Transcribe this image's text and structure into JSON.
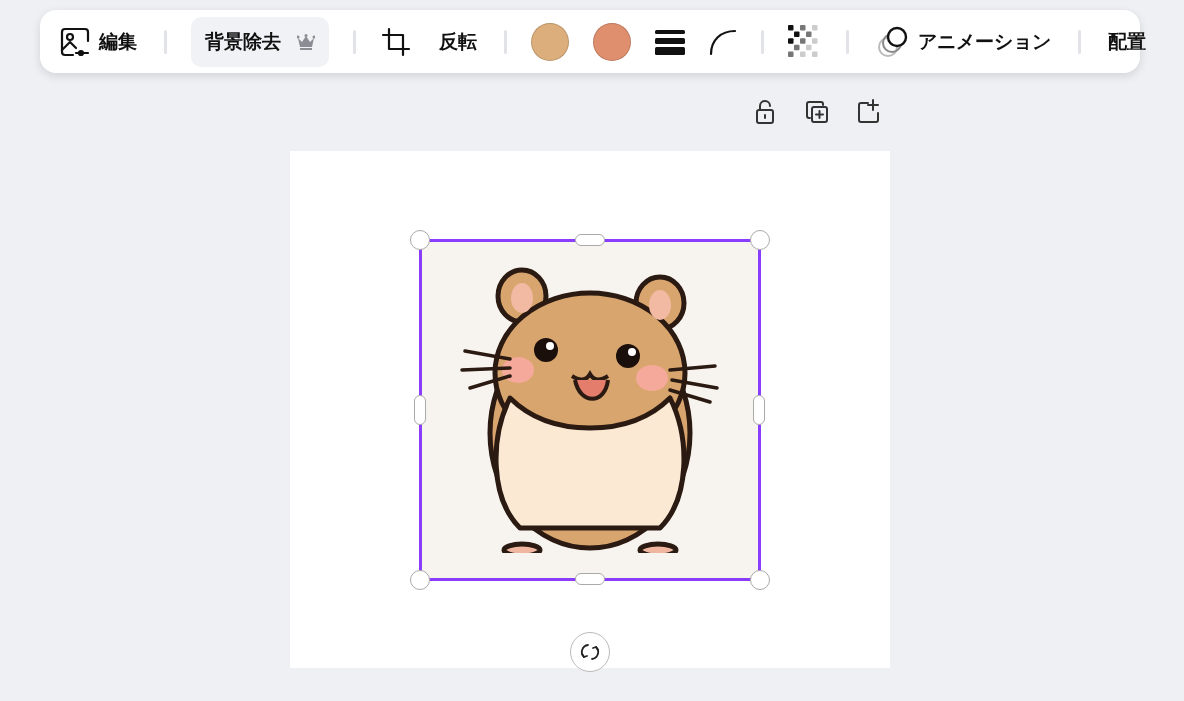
{
  "toolbar": {
    "items": [
      {
        "kind": "edit",
        "label": "編集",
        "selected": false
      },
      {
        "kind": "divider"
      },
      {
        "kind": "button",
        "label": "背景除去",
        "premium": true,
        "selected": true
      },
      {
        "kind": "divider"
      },
      {
        "kind": "crop",
        "selected": false
      },
      {
        "kind": "button",
        "label": "反転",
        "selected": false
      },
      {
        "kind": "divider"
      },
      {
        "kind": "swatch",
        "color": "#dcae7b",
        "selected": false
      },
      {
        "kind": "swatch",
        "color": "#df8e6e",
        "selected": false
      },
      {
        "kind": "border",
        "selected": false
      },
      {
        "kind": "corner",
        "selected": false
      },
      {
        "kind": "divider"
      },
      {
        "kind": "transparency",
        "selected": false
      },
      {
        "kind": "divider"
      },
      {
        "kind": "animation",
        "label": "アニメーション",
        "selected": false
      },
      {
        "kind": "divider"
      },
      {
        "kind": "button",
        "label": "配置",
        "selected": false
      }
    ]
  },
  "page_actions": [
    {
      "kind": "lock"
    },
    {
      "kind": "duplicate"
    },
    {
      "kind": "add"
    }
  ],
  "canvas": {
    "image": {
      "selected": true
    }
  }
}
